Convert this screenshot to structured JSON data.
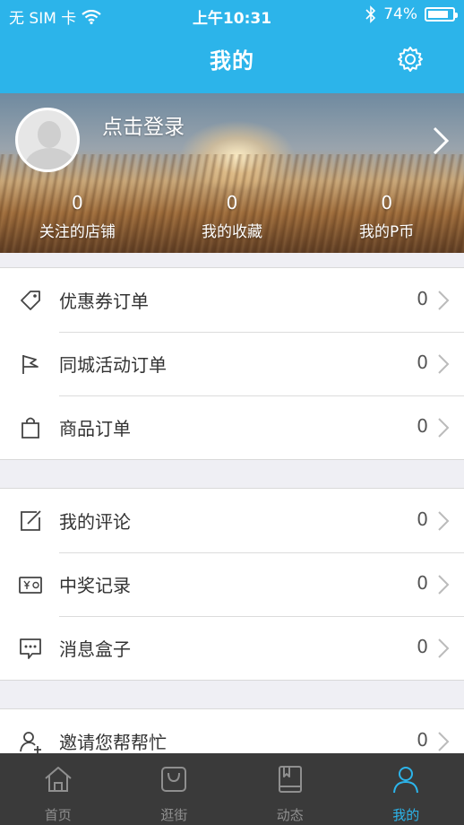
{
  "status_bar": {
    "carrier": "无 SIM 卡",
    "time": "上午10:31",
    "battery": "74%",
    "battery_level": 0.74
  },
  "header": {
    "title": "我的",
    "settings_icon": "gear-icon"
  },
  "profile": {
    "login_text": "点击登录",
    "stats": [
      {
        "value": "0",
        "label": "关注的店铺"
      },
      {
        "value": "0",
        "label": "我的收藏"
      },
      {
        "value": "0",
        "label": "我的P币"
      }
    ]
  },
  "menu_groups": [
    [
      {
        "label": "优惠券订单",
        "count": "0",
        "icon": "tag-icon"
      },
      {
        "label": "同城活动订单",
        "count": "0",
        "icon": "flag-icon"
      },
      {
        "label": "商品订单",
        "count": "0",
        "icon": "shopping-bag-icon"
      }
    ],
    [
      {
        "label": "我的评论",
        "count": "0",
        "icon": "edit-icon"
      },
      {
        "label": "中奖记录",
        "count": "0",
        "icon": "ticket-icon"
      },
      {
        "label": "消息盒子",
        "count": "0",
        "icon": "message-icon"
      }
    ],
    [
      {
        "label": "邀请您帮帮忙",
        "count": "0",
        "icon": "add-user-icon"
      }
    ]
  ],
  "tabs": [
    {
      "label": "首页",
      "icon": "home-icon"
    },
    {
      "label": "逛街",
      "icon": "shopping-bag-icon"
    },
    {
      "label": "动态",
      "icon": "book-icon"
    },
    {
      "label": "我的",
      "icon": "user-icon",
      "active": true
    }
  ],
  "colors": {
    "accent": "#2cb4ea",
    "tabbar": "#3a3a3a"
  }
}
